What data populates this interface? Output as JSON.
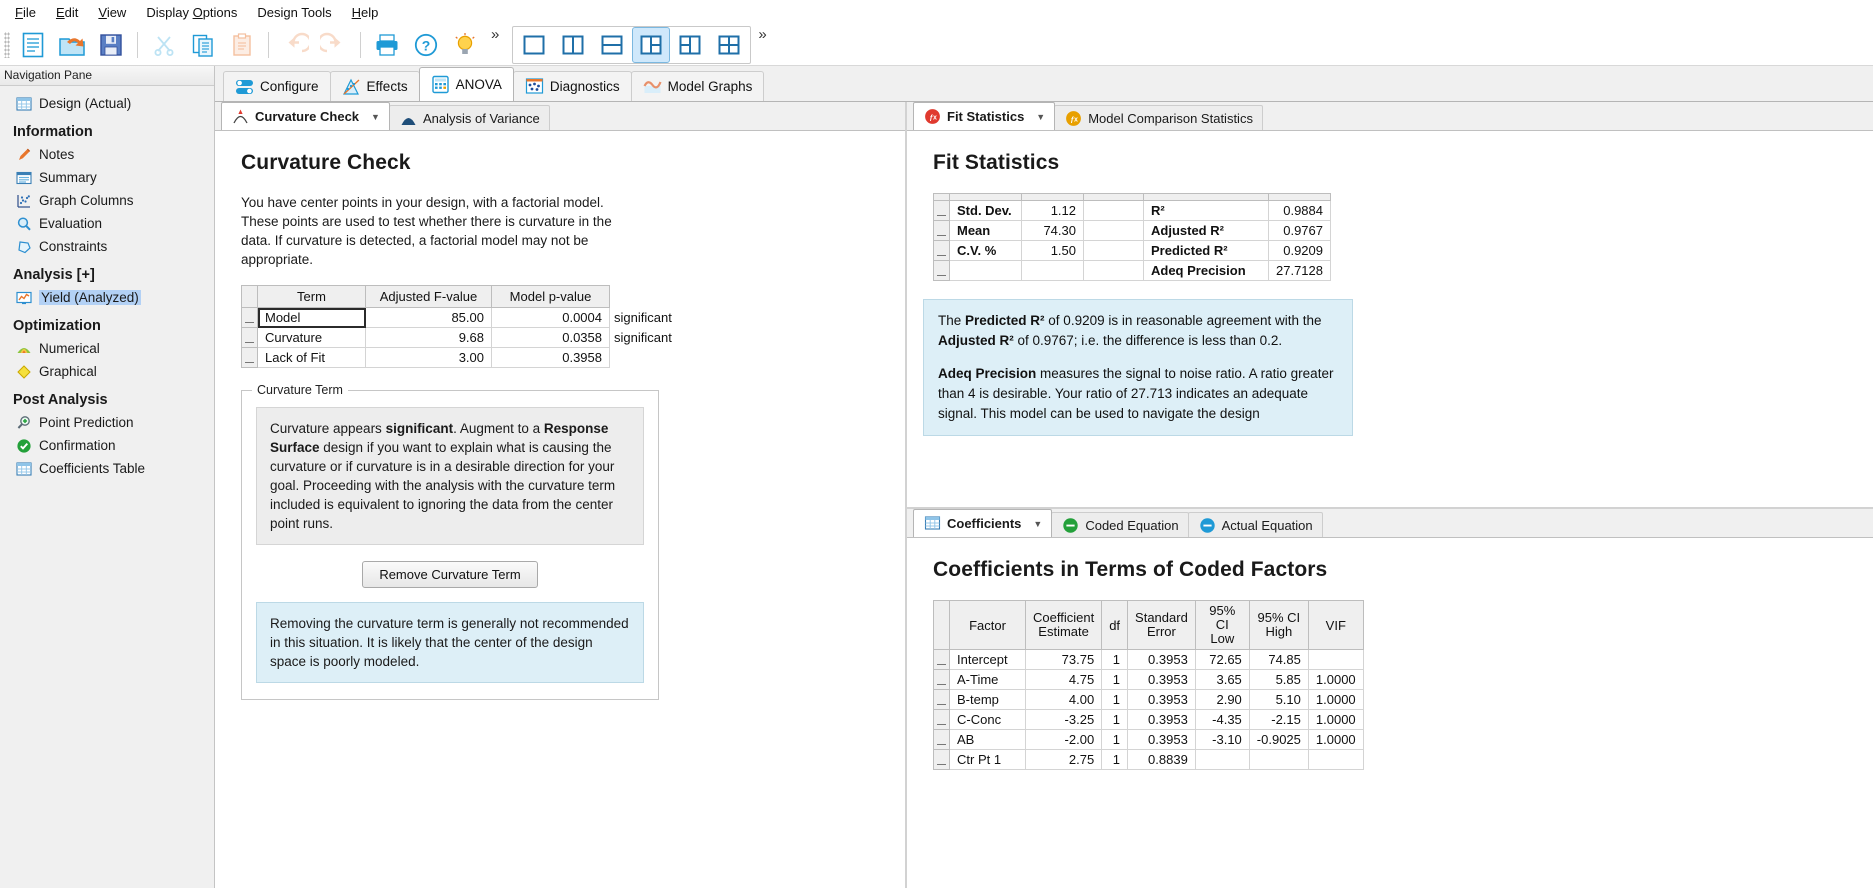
{
  "menu": {
    "items": [
      {
        "label": "File",
        "accel": "F"
      },
      {
        "label": "Edit",
        "accel": "E"
      },
      {
        "label": "View",
        "accel": "V"
      },
      {
        "label": "Display Options",
        "accel": "O"
      },
      {
        "label": "Design Tools",
        "accel": "g"
      },
      {
        "label": "Help",
        "accel": "H"
      }
    ]
  },
  "toolbar": {
    "buttons": [
      {
        "name": "new-icon",
        "title": "New"
      },
      {
        "name": "open-folder-icon",
        "title": "Open"
      },
      {
        "name": "save-icon",
        "title": "Save"
      },
      {
        "name": "cut-scissors-icon",
        "title": "Cut"
      },
      {
        "name": "copy-icon",
        "title": "Copy"
      },
      {
        "name": "paste-icon",
        "title": "Paste"
      },
      {
        "name": "undo-icon",
        "title": "Undo"
      },
      {
        "name": "redo-icon",
        "title": "Redo"
      },
      {
        "name": "print-icon",
        "title": "Print"
      },
      {
        "name": "help-question-icon",
        "title": "Help"
      },
      {
        "name": "tip-bulb-icon",
        "title": "Tips"
      }
    ],
    "overflow_label": "»",
    "layout_buttons": [
      {
        "name": "layout-single-icon",
        "active": false
      },
      {
        "name": "layout-two-vertical-icon",
        "active": false
      },
      {
        "name": "layout-two-horizontal-icon",
        "active": false
      },
      {
        "name": "layout-one-left-two-right-icon",
        "active": true
      },
      {
        "name": "layout-three-panel-icon",
        "active": false
      },
      {
        "name": "layout-four-grid-icon",
        "active": false
      }
    ]
  },
  "navigation": {
    "title": "Navigation Pane",
    "items": [
      {
        "label": "Design (Actual)",
        "icon": "grid-table-icon",
        "type": "item",
        "selected": false
      },
      {
        "label": "Information",
        "type": "header"
      },
      {
        "label": "Notes",
        "icon": "pencil-icon",
        "type": "item",
        "selected": false
      },
      {
        "label": "Summary",
        "icon": "summary-lines-icon",
        "type": "item",
        "selected": false
      },
      {
        "label": "Graph Columns",
        "icon": "scatter-graph-icon",
        "type": "item",
        "selected": false
      },
      {
        "label": "Evaluation",
        "icon": "magnifier-icon",
        "type": "item",
        "selected": false
      },
      {
        "label": "Constraints",
        "icon": "polygon-icon",
        "type": "item",
        "selected": false
      },
      {
        "label": "Analysis [+]",
        "type": "header"
      },
      {
        "label": "Yield (Analyzed)",
        "icon": "monitor-chart-icon",
        "type": "item",
        "selected": true
      },
      {
        "label": "Optimization",
        "type": "header"
      },
      {
        "label": "Numerical",
        "icon": "numerical-hill-icon",
        "type": "item",
        "selected": false
      },
      {
        "label": "Graphical",
        "icon": "yellow-diamond-icon",
        "type": "item",
        "selected": false
      },
      {
        "label": "Post Analysis",
        "type": "header"
      },
      {
        "label": "Point Prediction",
        "icon": "magnifier-plus-icon",
        "type": "item",
        "selected": false
      },
      {
        "label": "Confirmation",
        "icon": "green-check-icon",
        "type": "item",
        "selected": false
      },
      {
        "label": "Coefficients Table",
        "icon": "grid-table-icon",
        "type": "item",
        "selected": false
      }
    ]
  },
  "main_tabs": [
    {
      "label": "Configure",
      "icon": "toggle-switch-icon",
      "active": false
    },
    {
      "label": "Effects",
      "icon": "effects-plot-icon",
      "active": false
    },
    {
      "label": "ANOVA",
      "icon": "calculator-icon",
      "active": true
    },
    {
      "label": "Diagnostics",
      "icon": "diagnostics-dots-icon",
      "active": false
    },
    {
      "label": "Model Graphs",
      "icon": "model-graph-curve-icon",
      "active": false
    }
  ],
  "left_pane": {
    "sub_tabs": [
      {
        "label": "Curvature Check",
        "icon": "curvature-peak-icon",
        "active": true,
        "has_dropdown": true
      },
      {
        "label": "Analysis of Variance",
        "icon": "anova-bell-icon",
        "active": false,
        "has_dropdown": false
      }
    ],
    "title": "Curvature Check",
    "description": "You have center points in your design, with a factorial model. These points are used to test whether there is curvature in the data. If curvature is detected, a factorial model may not be appropriate.",
    "curvature_table": {
      "columns": [
        "Term",
        "Adjusted F-value",
        "Model p-value",
        ""
      ],
      "rows": [
        {
          "term": "Model",
          "f_value": "85.00",
          "p_value": "0.0004",
          "note": "significant",
          "selected": true
        },
        {
          "term": "Curvature",
          "f_value": "9.68",
          "p_value": "0.0358",
          "note": "significant",
          "selected": false
        },
        {
          "term": "Lack of Fit",
          "f_value": "3.00",
          "p_value": "0.3958",
          "note": "",
          "selected": false
        }
      ]
    },
    "curvature_term_group": {
      "legend": "Curvature Term",
      "info_parts": [
        {
          "text": "Curvature appears ",
          "bold": false
        },
        {
          "text": "significant",
          "bold": true
        },
        {
          "text": ". Augment to a ",
          "bold": false
        },
        {
          "text": "Response Surface",
          "bold": true
        },
        {
          "text": " design if you want to explain what is causing the curvature or if curvature is in a desirable direction for your goal. Proceeding with the analysis with the curvature term included is equivalent to ignoring the data from the center point runs.",
          "bold": false
        }
      ],
      "button_label": "Remove Curvature Term",
      "tip_text": "Removing the curvature term is generally not recommended in this situation. It is likely that the center of the design space is poorly modeled."
    }
  },
  "right_pane": {
    "top_sub_tabs": [
      {
        "label": "Fit Statistics",
        "icon": "fit-stats-icon",
        "active": true,
        "has_dropdown": true
      },
      {
        "label": "Model Comparison Statistics",
        "icon": "model-comparison-icon",
        "active": false,
        "has_dropdown": false
      }
    ],
    "fit_title": "Fit Statistics",
    "fit_table": {
      "rows": [
        {
          "label_left": "Std. Dev.",
          "value_left": "1.12",
          "label_right": "R²",
          "value_right": "0.9884"
        },
        {
          "label_left": "Mean",
          "value_left": "74.30",
          "label_right": "Adjusted R²",
          "value_right": "0.9767"
        },
        {
          "label_left": "C.V. %",
          "value_left": "1.50",
          "label_right": "Predicted R²",
          "value_right": "0.9209"
        },
        {
          "label_left": "",
          "value_left": "",
          "label_right": "Adeq Precision",
          "value_right": "27.7128"
        }
      ]
    },
    "fit_notes": [
      [
        {
          "text": "The ",
          "bold": false
        },
        {
          "text": "Predicted R²",
          "bold": true
        },
        {
          "text": " of 0.9209 is in reasonable agreement with the ",
          "bold": false
        },
        {
          "text": "Adjusted R²",
          "bold": true
        },
        {
          "text": " of 0.9767; i.e. the difference is less than 0.2.",
          "bold": false
        }
      ],
      [
        {
          "text": "Adeq Precision",
          "bold": true
        },
        {
          "text": " measures the signal to noise ratio. A ratio greater than 4 is desirable. Your ratio of 27.713 indicates an adequate signal. This model can be used to navigate the design",
          "bold": false
        }
      ]
    ],
    "bottom_sub_tabs": [
      {
        "label": "Coefficients",
        "icon": "coefficients-grid-icon",
        "active": true,
        "has_dropdown": true
      },
      {
        "label": "Coded Equation",
        "icon": "coded-equation-icon",
        "active": false,
        "has_dropdown": false
      },
      {
        "label": "Actual Equation",
        "icon": "actual-equation-icon",
        "active": false,
        "has_dropdown": false
      }
    ],
    "coef_title": "Coefficients in Terms of Coded Factors",
    "coef_table": {
      "columns": [
        "Factor",
        "Coefficient Estimate",
        "df",
        "Standard Error",
        "95% CI Low",
        "95% CI High",
        "VIF"
      ],
      "rows": [
        {
          "factor": "Intercept",
          "estimate": "73.75",
          "df": "1",
          "stderr": "0.3953",
          "ci_low": "72.65",
          "ci_high": "74.85",
          "vif": ""
        },
        {
          "factor": "A-Time",
          "estimate": "4.75",
          "df": "1",
          "stderr": "0.3953",
          "ci_low": "3.65",
          "ci_high": "5.85",
          "vif": "1.0000"
        },
        {
          "factor": "B-temp",
          "estimate": "4.00",
          "df": "1",
          "stderr": "0.3953",
          "ci_low": "2.90",
          "ci_high": "5.10",
          "vif": "1.0000"
        },
        {
          "factor": "C-Conc",
          "estimate": "-3.25",
          "df": "1",
          "stderr": "0.3953",
          "ci_low": "-4.35",
          "ci_high": "-2.15",
          "vif": "1.0000"
        },
        {
          "factor": "AB",
          "estimate": "-2.00",
          "df": "1",
          "stderr": "0.3953",
          "ci_low": "-3.10",
          "ci_high": "-0.9025",
          "vif": "1.0000"
        },
        {
          "factor": "Ctr Pt 1",
          "estimate": "2.75",
          "df": "1",
          "stderr": "0.8839",
          "ci_low": "",
          "ci_high": "",
          "vif": ""
        }
      ]
    }
  },
  "colors": {
    "accent_blue": "#1f9ad6",
    "selection_blue": "#b3d1f5",
    "tip_blue_bg": "#ddeff7",
    "orange": "#e8762c",
    "green": "#23a03a"
  }
}
